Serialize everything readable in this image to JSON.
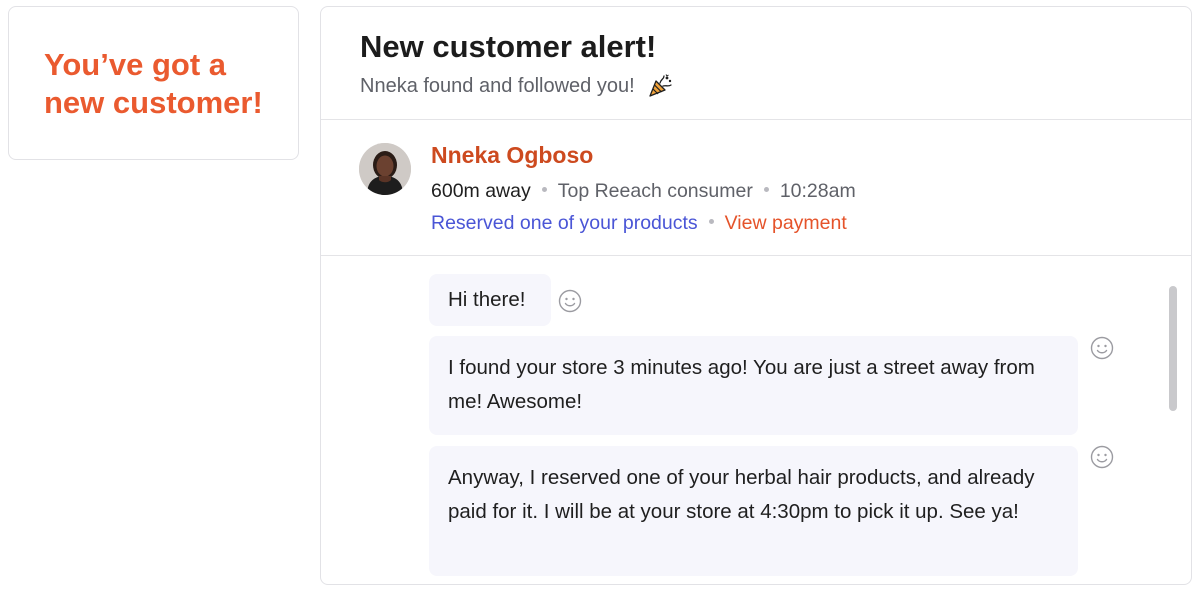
{
  "promo": {
    "headline": "You’ve got a new customer!",
    "color": "#ea5a2f"
  },
  "alert": {
    "title": "New customer alert!",
    "subtitle": "Nneka found and followed you!",
    "subtitle_icon": "party-popper-icon"
  },
  "customer": {
    "name": "Nneka Ogboso",
    "distance": "600m away",
    "segment": "Top Reeach consumer",
    "time": "10:28am",
    "reserved_link": "Reserved one of your products",
    "payment_link": "View payment",
    "avatar_icon": "avatar"
  },
  "messages": [
    {
      "text": "Hi there!"
    },
    {
      "text": "I found your store 3 minutes ago! You are just a street away from me! Awesome!"
    },
    {
      "text": "Anyway, I reserved one of your herbal hair products, and already paid for it. I will be at your store at 4:30pm to pick it up. See ya!"
    }
  ],
  "colors": {
    "accent_orange": "#ea5a2f",
    "name_orange": "#cd4a1f",
    "link_blue": "#4a55d6",
    "bubble_bg": "#f6f6fc"
  }
}
